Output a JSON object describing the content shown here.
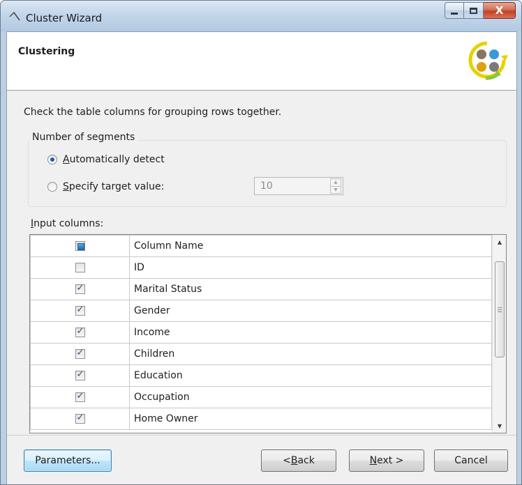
{
  "window": {
    "title": "Cluster Wizard"
  },
  "header": {
    "title": "Clustering"
  },
  "instruction": "Check the table columns for grouping rows together.",
  "segments": {
    "legend": "Number of segments",
    "auto": {
      "prefix": "",
      "accel": "A",
      "rest": "utomatically detect",
      "selected": true
    },
    "specify": {
      "prefix": "",
      "accel": "S",
      "rest": "pecify target value:",
      "selected": false
    },
    "target_value": "10"
  },
  "input_columns": {
    "label_accel": "I",
    "label_rest": "nput columns:",
    "header": "Column Name",
    "rows": [
      {
        "name": "ID",
        "checked": false
      },
      {
        "name": "Marital Status",
        "checked": true
      },
      {
        "name": "Gender",
        "checked": true
      },
      {
        "name": "Income",
        "checked": true
      },
      {
        "name": "Children",
        "checked": true
      },
      {
        "name": "Education",
        "checked": true
      },
      {
        "name": "Occupation",
        "checked": true
      },
      {
        "name": "Home Owner",
        "checked": true
      }
    ]
  },
  "buttons": {
    "parameters": "Parameters...",
    "back": {
      "prefix": "< ",
      "accel": "B",
      "rest": "ack"
    },
    "next": {
      "prefix": "",
      "accel": "N",
      "rest": "ext >"
    },
    "cancel": "Cancel"
  },
  "colors": {
    "accent": "#3c7fb1",
    "close": "#c2401f"
  },
  "icons": [
    "wizard-app-icon",
    "minimize-icon",
    "maximize-icon",
    "close-icon",
    "clustering-icon",
    "scroll-up-icon",
    "scroll-down-icon"
  ]
}
